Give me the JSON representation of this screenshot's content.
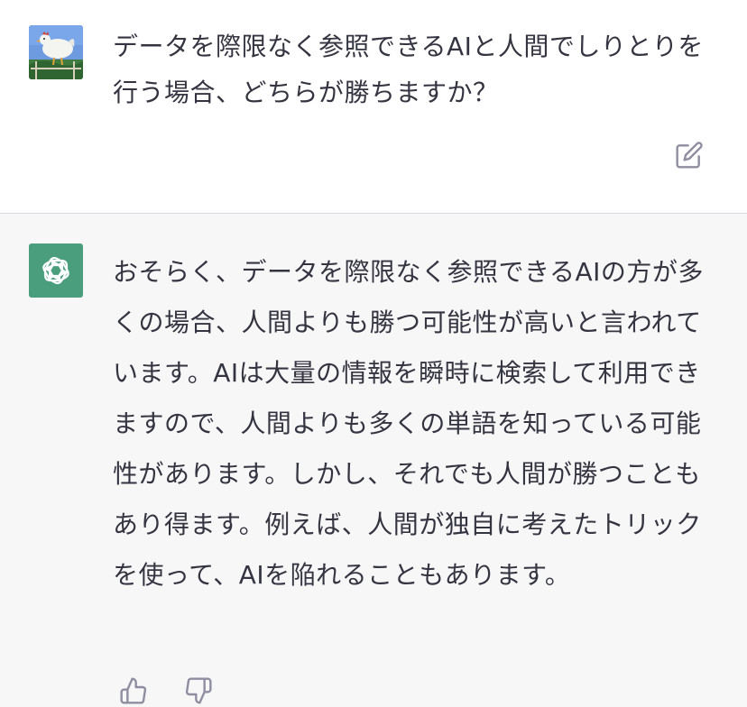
{
  "conversation": {
    "user_message": {
      "avatar_icon": "chicken-avatar-icon",
      "text": "データを際限なく参照できるAIと人間でしりとりを行う場合、どちらが勝ちますか？",
      "edit_icon": "edit-icon"
    },
    "assistant_message": {
      "avatar_icon": "openai-logo-icon",
      "text": "おそらく、データを際限なく参照できるAIの方が多くの場合、人間よりも勝つ可能性が高いと言われています。AIは大量の情報を瞬時に検索して利用できますので、人間よりも多くの単語を知っている可能性があります。しかし、それでも人間が勝つこともあり得ます。例えば、人間が独自に考えたトリックを使って、AIを陥れることもあります。",
      "feedback_icons": [
        "thumbs-up-icon",
        "thumbs-down-icon"
      ]
    }
  },
  "colors": {
    "user_bg": "#ffffff",
    "assistant_bg": "#f7f7f8",
    "avatar_green": "#4a9e7e",
    "text": "#343541",
    "icon_gray": "#8e8ea0"
  }
}
